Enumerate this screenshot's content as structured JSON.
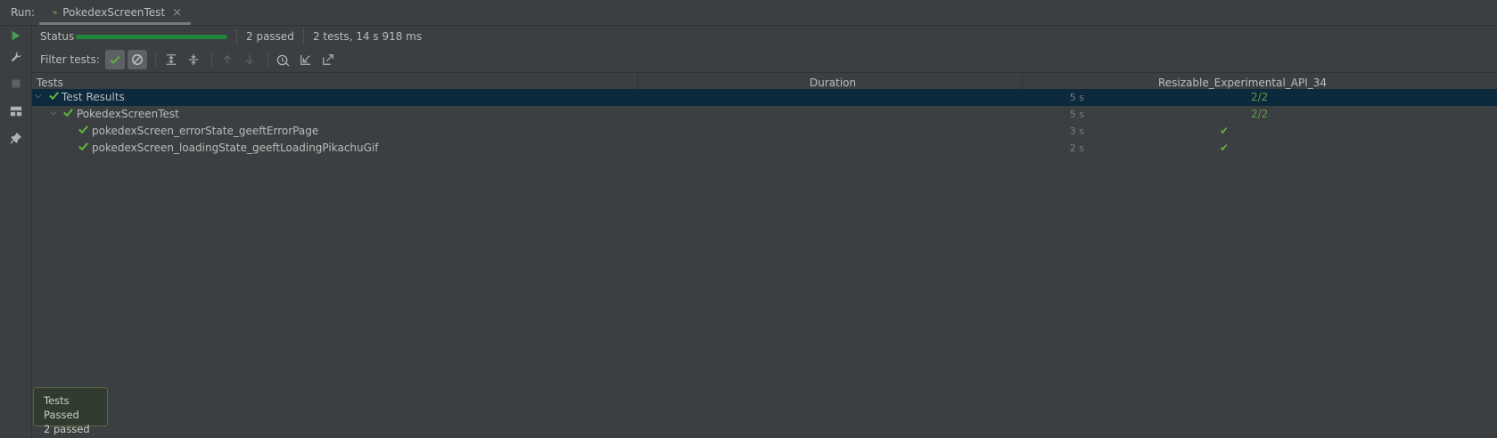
{
  "run": {
    "label": "Run:",
    "tab_title": "PokedexScreenTest",
    "tab_close": "×",
    "tab_icon": "android-test-icon"
  },
  "status": {
    "label": "Status",
    "progress": 1.0,
    "passed": "2 passed",
    "summary": "2 tests, 14 s 918 ms"
  },
  "filter": {
    "label": "Filter tests:"
  },
  "table": {
    "headers": [
      "Tests",
      "Duration",
      "Resizable_Experimental_API_34"
    ],
    "rows": [
      {
        "name": "Test Results",
        "duration": "5 s",
        "result": "2/2"
      },
      {
        "name": "PokedexScreenTest",
        "duration": "5 s",
        "result": "2/2"
      },
      {
        "name": "pokedexScreen_errorState_geeftErrorPage",
        "duration": "3 s",
        "result": "✔"
      },
      {
        "name": "pokedexScreen_loadingState_geeftLoadingPikachuGif",
        "duration": "2 s",
        "result": "✔"
      }
    ]
  },
  "toast": {
    "title": "Tests Passed",
    "detail": "2 passed"
  },
  "colors": {
    "pass_green": "#5fb43c",
    "progress_green": "#21873a",
    "selection": "#0d293e"
  }
}
